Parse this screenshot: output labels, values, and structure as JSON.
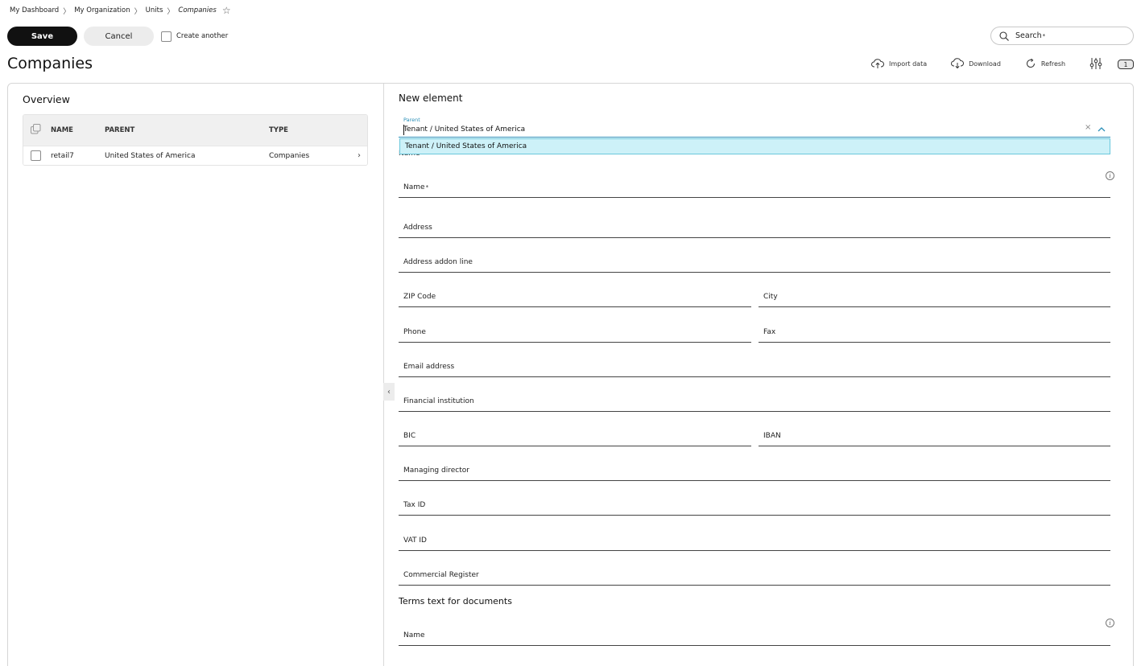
{
  "breadcrumb": {
    "items": [
      "My Dashboard",
      "My Organization",
      "Units"
    ],
    "current": "Companies",
    "separator": "〉",
    "favorite_icon": "star-outline-icon"
  },
  "toolbar": {
    "save_label": "Save",
    "cancel_label": "Cancel",
    "create_another_label": "Create another"
  },
  "search": {
    "label": "Search",
    "required_mark": "*"
  },
  "page": {
    "title": "Companies"
  },
  "actions": {
    "import_label": "Import data",
    "download_label": "Download",
    "refresh_label": "Refresh",
    "settings_icon": "sliders-icon",
    "badge_count": "1"
  },
  "overview": {
    "title": "Overview",
    "columns": [
      "NAME",
      "PARENT",
      "TYPE"
    ],
    "rows": [
      {
        "name": "retail7",
        "parent": "United States of America",
        "type": "Companies",
        "chevron": "›"
      }
    ]
  },
  "new_element": {
    "title": "New element",
    "parent_label": "Parent",
    "parent_value": "Tenant / United States of America",
    "clear_icon": "×",
    "dropdown_option": "Tenant / United States of America",
    "hidden_label": "Name",
    "fields": {
      "name": "Name",
      "name_required": "*",
      "address": "Address",
      "address_addon": "Address addon line",
      "zip": "ZIP Code",
      "city": "City",
      "phone": "Phone",
      "fax": "Fax",
      "email": "Email address",
      "financial_institution": "Financial institution",
      "bic": "BIC",
      "iban": "IBAN",
      "managing_director": "Managing director",
      "tax_id": "Tax ID",
      "vat_id": "VAT ID",
      "commercial_register": "Commercial Register"
    },
    "terms": {
      "title": "Terms text for documents",
      "name": "Name"
    },
    "info_glyph": "i"
  },
  "colors": {
    "primary_button": "#111111",
    "accent": "#2a8fb8",
    "dropdown_highlight": "#cdf1f8"
  }
}
